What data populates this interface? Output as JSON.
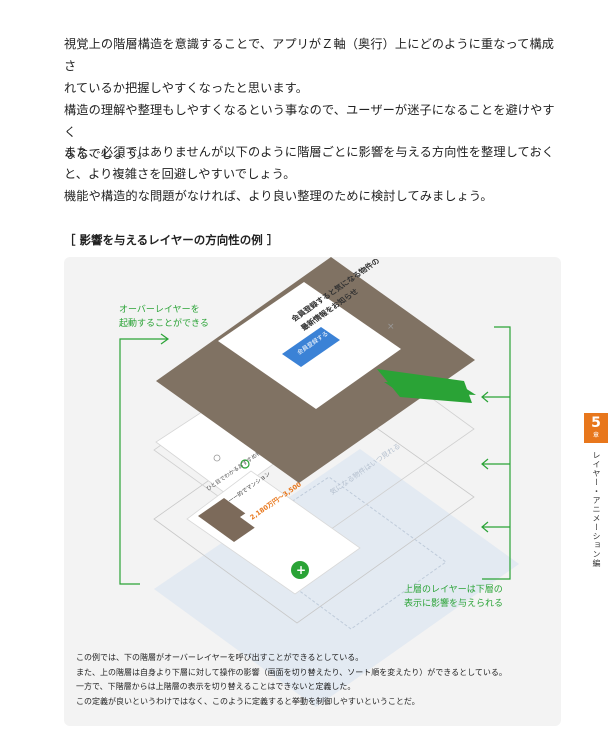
{
  "body": {
    "paragraph1": [
      "視覚上の階層構造を意識することで、アプリがＺ軸（奥行）上にどのように重なって構成さ",
      "れているか把握しやすくなったと思います。",
      "構造の理解や整理もしやすくなるという事なので、ユーザーが迷子になることを避けやすく",
      "なるでしょう。"
    ],
    "paragraph2": [
      "また、必須ではありませんが以下のように階層ごとに影響を与える方向性を整理しておく",
      "と、より複雑さを回避しやすいでしょう。",
      "機能や構造的な問題がなければ、より良い整理のために検討してみましょう。"
    ]
  },
  "figure": {
    "title": "［ 影響を与えるレイヤーの方向性の例 ］",
    "note_top": [
      "オーバーレイヤーを",
      "起動することができる"
    ],
    "note_bottom": [
      "上層のレイヤーは下層の",
      "表示に影響を与えられる"
    ],
    "modal": {
      "message_line1": "会員登録すると気になる物件の",
      "message_line2": "最新情報をお知らせ",
      "button_label": "会員登録する"
    },
    "card": {
      "header": "ひと目でわかるおすすめ物件",
      "title": "一ー的でマンション",
      "price": "2,180万円〜3,500",
      "plus_label": "+"
    },
    "ghost_text": "気になる物件はいつ見れる",
    "caption": [
      "この例では、下の階層がオーバーレイヤーを呼び出すことができるとしている。",
      "また、上の階層は自身より下層に対して操作の影響（画面を切り替えたり、ソート順を変えたり）ができるとしている。",
      "一方で、下階層からは上階層の表示を切り替えることはできないと定義した。",
      "この定義が良いというわけではなく、このように定義すると挙動を制御しやすいということだ。"
    ],
    "colors": {
      "accent_green": "#2aa336",
      "overlay_dark": "#807263",
      "modal_button_blue": "#3b82d6",
      "figure_background": "#f3f3f3"
    }
  },
  "sidebar": {
    "chapter_number": "5",
    "chapter_unit": "章",
    "chapter_title": "レイヤー・アニメーション編",
    "chapter_color": "#e8771c"
  }
}
